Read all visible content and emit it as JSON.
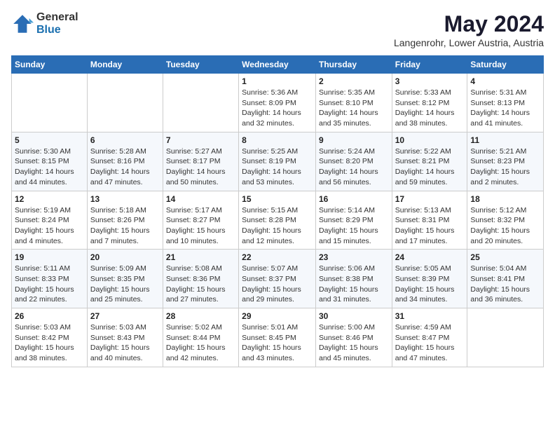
{
  "header": {
    "logo_general": "General",
    "logo_blue": "Blue",
    "month_year": "May 2024",
    "location": "Langenrohr, Lower Austria, Austria"
  },
  "days_of_week": [
    "Sunday",
    "Monday",
    "Tuesday",
    "Wednesday",
    "Thursday",
    "Friday",
    "Saturday"
  ],
  "weeks": [
    [
      {
        "day": "",
        "info": ""
      },
      {
        "day": "",
        "info": ""
      },
      {
        "day": "",
        "info": ""
      },
      {
        "day": "1",
        "info": "Sunrise: 5:36 AM\nSunset: 8:09 PM\nDaylight: 14 hours\nand 32 minutes."
      },
      {
        "day": "2",
        "info": "Sunrise: 5:35 AM\nSunset: 8:10 PM\nDaylight: 14 hours\nand 35 minutes."
      },
      {
        "day": "3",
        "info": "Sunrise: 5:33 AM\nSunset: 8:12 PM\nDaylight: 14 hours\nand 38 minutes."
      },
      {
        "day": "4",
        "info": "Sunrise: 5:31 AM\nSunset: 8:13 PM\nDaylight: 14 hours\nand 41 minutes."
      }
    ],
    [
      {
        "day": "5",
        "info": "Sunrise: 5:30 AM\nSunset: 8:15 PM\nDaylight: 14 hours\nand 44 minutes."
      },
      {
        "day": "6",
        "info": "Sunrise: 5:28 AM\nSunset: 8:16 PM\nDaylight: 14 hours\nand 47 minutes."
      },
      {
        "day": "7",
        "info": "Sunrise: 5:27 AM\nSunset: 8:17 PM\nDaylight: 14 hours\nand 50 minutes."
      },
      {
        "day": "8",
        "info": "Sunrise: 5:25 AM\nSunset: 8:19 PM\nDaylight: 14 hours\nand 53 minutes."
      },
      {
        "day": "9",
        "info": "Sunrise: 5:24 AM\nSunset: 8:20 PM\nDaylight: 14 hours\nand 56 minutes."
      },
      {
        "day": "10",
        "info": "Sunrise: 5:22 AM\nSunset: 8:21 PM\nDaylight: 14 hours\nand 59 minutes."
      },
      {
        "day": "11",
        "info": "Sunrise: 5:21 AM\nSunset: 8:23 PM\nDaylight: 15 hours\nand 2 minutes."
      }
    ],
    [
      {
        "day": "12",
        "info": "Sunrise: 5:19 AM\nSunset: 8:24 PM\nDaylight: 15 hours\nand 4 minutes."
      },
      {
        "day": "13",
        "info": "Sunrise: 5:18 AM\nSunset: 8:26 PM\nDaylight: 15 hours\nand 7 minutes."
      },
      {
        "day": "14",
        "info": "Sunrise: 5:17 AM\nSunset: 8:27 PM\nDaylight: 15 hours\nand 10 minutes."
      },
      {
        "day": "15",
        "info": "Sunrise: 5:15 AM\nSunset: 8:28 PM\nDaylight: 15 hours\nand 12 minutes."
      },
      {
        "day": "16",
        "info": "Sunrise: 5:14 AM\nSunset: 8:29 PM\nDaylight: 15 hours\nand 15 minutes."
      },
      {
        "day": "17",
        "info": "Sunrise: 5:13 AM\nSunset: 8:31 PM\nDaylight: 15 hours\nand 17 minutes."
      },
      {
        "day": "18",
        "info": "Sunrise: 5:12 AM\nSunset: 8:32 PM\nDaylight: 15 hours\nand 20 minutes."
      }
    ],
    [
      {
        "day": "19",
        "info": "Sunrise: 5:11 AM\nSunset: 8:33 PM\nDaylight: 15 hours\nand 22 minutes."
      },
      {
        "day": "20",
        "info": "Sunrise: 5:09 AM\nSunset: 8:35 PM\nDaylight: 15 hours\nand 25 minutes."
      },
      {
        "day": "21",
        "info": "Sunrise: 5:08 AM\nSunset: 8:36 PM\nDaylight: 15 hours\nand 27 minutes."
      },
      {
        "day": "22",
        "info": "Sunrise: 5:07 AM\nSunset: 8:37 PM\nDaylight: 15 hours\nand 29 minutes."
      },
      {
        "day": "23",
        "info": "Sunrise: 5:06 AM\nSunset: 8:38 PM\nDaylight: 15 hours\nand 31 minutes."
      },
      {
        "day": "24",
        "info": "Sunrise: 5:05 AM\nSunset: 8:39 PM\nDaylight: 15 hours\nand 34 minutes."
      },
      {
        "day": "25",
        "info": "Sunrise: 5:04 AM\nSunset: 8:41 PM\nDaylight: 15 hours\nand 36 minutes."
      }
    ],
    [
      {
        "day": "26",
        "info": "Sunrise: 5:03 AM\nSunset: 8:42 PM\nDaylight: 15 hours\nand 38 minutes."
      },
      {
        "day": "27",
        "info": "Sunrise: 5:03 AM\nSunset: 8:43 PM\nDaylight: 15 hours\nand 40 minutes."
      },
      {
        "day": "28",
        "info": "Sunrise: 5:02 AM\nSunset: 8:44 PM\nDaylight: 15 hours\nand 42 minutes."
      },
      {
        "day": "29",
        "info": "Sunrise: 5:01 AM\nSunset: 8:45 PM\nDaylight: 15 hours\nand 43 minutes."
      },
      {
        "day": "30",
        "info": "Sunrise: 5:00 AM\nSunset: 8:46 PM\nDaylight: 15 hours\nand 45 minutes."
      },
      {
        "day": "31",
        "info": "Sunrise: 4:59 AM\nSunset: 8:47 PM\nDaylight: 15 hours\nand 47 minutes."
      },
      {
        "day": "",
        "info": ""
      }
    ]
  ]
}
